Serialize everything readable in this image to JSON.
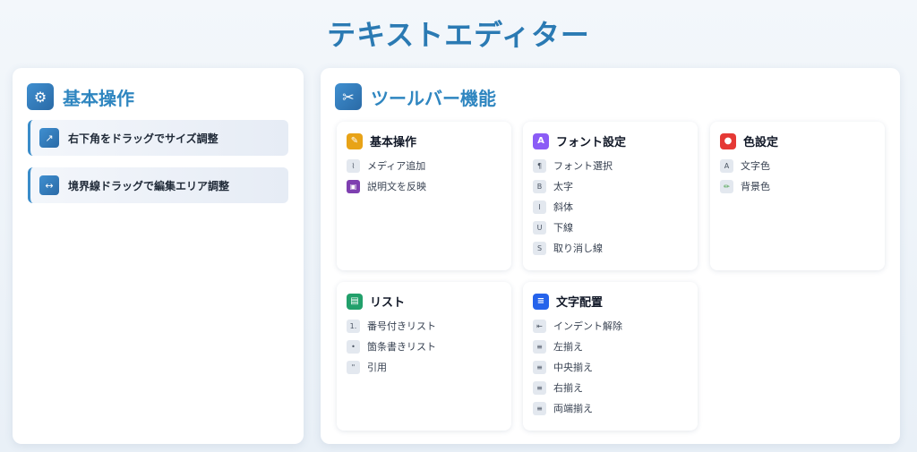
{
  "app": {
    "title": "テキストエディター"
  },
  "basic_panel": {
    "title": "基本操作",
    "icon": "gear-icon",
    "tips": [
      {
        "label": "右下角をドラッグでサイズ調整",
        "icon": "resize-arrow-icon"
      },
      {
        "label": "境界線ドラッグで編集エリア調整",
        "icon": "horizontal-resize-icon"
      }
    ]
  },
  "toolbar_panel": {
    "title": "ツールバー機能",
    "icon": "tools-icon",
    "cards": [
      {
        "title": "基本操作",
        "icon": "pin-icon",
        "accent": "#e8a317",
        "items": [
          {
            "label": "メディア追加",
            "icon": "paperclip-icon"
          },
          {
            "label": "説明文を反映",
            "icon": "floppy-disk-icon"
          }
        ]
      },
      {
        "title": "フォント設定",
        "icon": "font-icon",
        "accent": "#8b5cf6",
        "icon_char": "A",
        "items": [
          {
            "label": "フォント選択",
            "icon": "pilcrow-icon",
            "char": "¶"
          },
          {
            "label": "太字",
            "icon": "bold-icon",
            "char": "B"
          },
          {
            "label": "斜体",
            "icon": "italic-icon",
            "char": "I"
          },
          {
            "label": "下線",
            "icon": "underline-icon",
            "char": "U"
          },
          {
            "label": "取り消し線",
            "icon": "strikethrough-icon",
            "char": "S"
          }
        ]
      },
      {
        "title": "色設定",
        "icon": "palette-icon",
        "accent": "#e53935",
        "items": [
          {
            "label": "文字色",
            "icon": "text-color-icon",
            "char": "A"
          },
          {
            "label": "背景色",
            "icon": "highlighter-icon"
          }
        ]
      },
      {
        "title": "リスト",
        "icon": "clipboard-icon",
        "accent": "#22a06b",
        "items": [
          {
            "label": "番号付きリスト",
            "icon": "numbered-list-icon",
            "char": "1."
          },
          {
            "label": "箇条書きリスト",
            "icon": "bullet-list-icon",
            "char": "•"
          },
          {
            "label": "引用",
            "icon": "quote-icon",
            "char": "\""
          }
        ]
      },
      {
        "title": "文字配置",
        "icon": "align-icon",
        "accent": "#2563eb",
        "icon_char": "≡",
        "items": [
          {
            "label": "インデント解除",
            "icon": "outdent-icon",
            "char": "⇤"
          },
          {
            "label": "左揃え",
            "icon": "align-left-icon",
            "char": "≡"
          },
          {
            "label": "中央揃え",
            "icon": "align-center-icon",
            "char": "≡"
          },
          {
            "label": "右揃え",
            "icon": "align-right-icon",
            "char": "≡"
          },
          {
            "label": "両端揃え",
            "icon": "align-justify-icon",
            "char": "≡"
          }
        ]
      }
    ]
  }
}
